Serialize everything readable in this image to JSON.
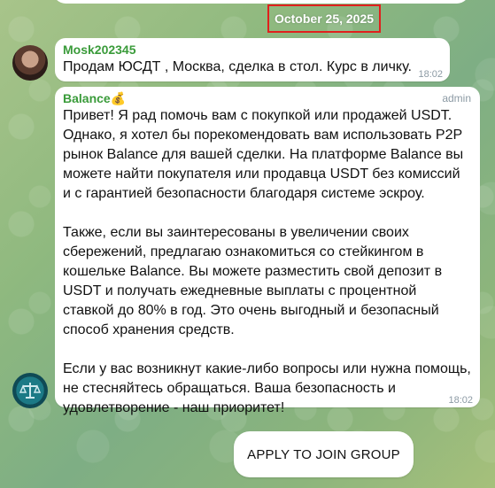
{
  "date_separator": "October 25, 2025",
  "messages": [
    {
      "sender": "Mosk202345",
      "text": "Продам ЮСДТ , Москва, сделка в стол. Курс в личку.",
      "time": "18:02"
    },
    {
      "sender": "Balance💰",
      "role": "admin",
      "text": "Привет! Я рад помочь вам с покупкой или продажей USDT. Однако, я хотел бы порекомендовать вам использовать P2P рынок Balance для вашей сделки. На платформе Balance вы можете найти покупателя или продавца USDT без комиссий и с гарантией безопасности благодаря системе эскроу.\n\nТакже, если вы заинтересованы в увеличении своих сбережений, предлагаю ознакомиться со стейкингом в кошельке Balance. Вы можете разместить свой депозит в USDT и получать ежедневные выплаты с процентной ставкой до 80% в год. Это очень выгодный и безопасный способ хранения средств.\n\nЕсли у вас возникнут какие-либо вопросы или нужна помощь, не стесняйтесь обращаться. Ваша безопасность и удовлетворение - наш приоритет!",
      "time": "18:02"
    }
  ],
  "join_button_label": "APPLY TO JOIN GROUP",
  "colors": {
    "sender_name": "#3a9b3a",
    "date_highlight_border": "#e0201d"
  },
  "icons": {
    "admin_avatar": "scales-icon"
  }
}
